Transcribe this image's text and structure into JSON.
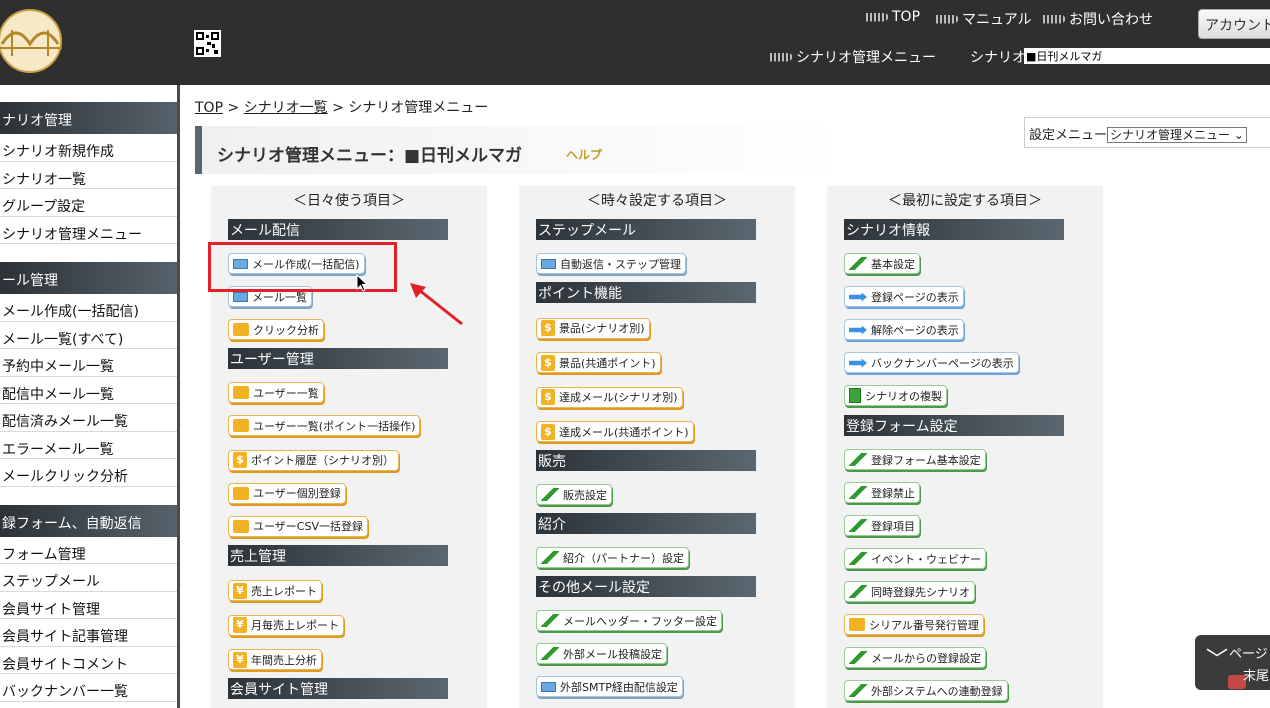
{
  "header": {
    "nav": [
      "TOP",
      "マニュアル",
      "お問い合わせ"
    ],
    "account_button": "アカウント",
    "scenario_menu_link": "シナリオ管理メニュー",
    "scenario_label": "シナリオ",
    "scenario_selected": "■日刊メルマガ"
  },
  "sidebar": {
    "sections": [
      {
        "title": "ナリオ管理",
        "items": [
          "シナリオ新規作成",
          "シナリオ一覧",
          "グループ設定",
          "シナリオ管理メニュー"
        ]
      },
      {
        "title": "ール管理",
        "items": [
          "メール作成(一括配信)",
          "メール一覧(すべて)",
          "予約中メール一覧",
          "配信中メール一覧",
          "配信済みメール一覧",
          "エラーメール一覧",
          "メールクリック分析"
        ]
      },
      {
        "title": "録フォーム、自動返信",
        "items": [
          "フォーム管理",
          "ステップメール",
          "会員サイト管理",
          "会員サイト記事管理",
          "会員サイトコメント",
          "バックナンバー一覧"
        ]
      }
    ]
  },
  "breadcrumb": {
    "top": "TOP",
    "sep": ">",
    "list": "シナリオ一覧",
    "current": "シナリオ管理メニュー"
  },
  "page": {
    "title": "シナリオ管理メニュー：■日刊メルマガ",
    "help": "ヘルプ",
    "settings_label": "設定メニュー",
    "settings_selected": "シナリオ管理メニュー"
  },
  "columns": [
    {
      "heading": "＜日々使う項目＞",
      "sections": [
        {
          "title": "メール配信",
          "items": [
            {
              "label": "メール作成(一括配信)",
              "icon": "mail-icon"
            },
            {
              "label": "メール一覧",
              "icon": "mail-icon"
            },
            {
              "label": "クリック分析",
              "icon": "card-icon"
            }
          ]
        },
        {
          "title": "ユーザー管理",
          "items": [
            {
              "label": "ユーザー一覧",
              "icon": "card-icon"
            },
            {
              "label": "ユーザー一覧(ポイント一括操作)",
              "icon": "card-icon"
            },
            {
              "label": "ポイント履歴（シナリオ別）",
              "icon": "coin-icon"
            },
            {
              "label": "ユーザー個別登録",
              "icon": "card-icon"
            },
            {
              "label": "ユーザーCSV一括登録",
              "icon": "card-icon"
            }
          ]
        },
        {
          "title": "売上管理",
          "items": [
            {
              "label": "売上レポート",
              "icon": "yen-icon"
            },
            {
              "label": "月毎売上レポート",
              "icon": "yen-icon"
            },
            {
              "label": "年間売上分析",
              "icon": "yen-icon"
            }
          ]
        },
        {
          "title": "会員サイト管理",
          "items": []
        }
      ]
    },
    {
      "heading": "＜時々設定する項目＞",
      "sections": [
        {
          "title": "ステップメール",
          "items": [
            {
              "label": "自動返信・ステップ管理",
              "icon": "mail-icon"
            }
          ]
        },
        {
          "title": "ポイント機能",
          "items": [
            {
              "label": "景品(シナリオ別)",
              "icon": "coin-icon"
            },
            {
              "label": "景品(共通ポイント)",
              "icon": "coin-icon"
            },
            {
              "label": "達成メール(シナリオ別)",
              "icon": "coin-icon"
            },
            {
              "label": "達成メール(共通ポイント)",
              "icon": "coin-icon"
            }
          ]
        },
        {
          "title": "販売",
          "items": [
            {
              "label": "販売設定",
              "icon": "pen-icon"
            }
          ]
        },
        {
          "title": "紹介",
          "items": [
            {
              "label": "紹介（パートナー）設定",
              "icon": "pen-icon"
            }
          ]
        },
        {
          "title": "その他メール設定",
          "items": [
            {
              "label": "メールヘッダー・フッター設定",
              "icon": "pen-icon"
            },
            {
              "label": "外部メール投稿設定",
              "icon": "pen-icon"
            },
            {
              "label": "外部SMTP経由配信設定",
              "icon": "mail-icon"
            }
          ]
        }
      ]
    },
    {
      "heading": "＜最初に設定する項目＞",
      "sections": [
        {
          "title": "シナリオ情報",
          "items": [
            {
              "label": "基本設定",
              "icon": "pen-icon"
            },
            {
              "label": "登録ページの表示",
              "icon": "arrow-icon"
            },
            {
              "label": "解除ページの表示",
              "icon": "arrow-icon"
            },
            {
              "label": "バックナンバーページの表示",
              "icon": "arrow-icon"
            },
            {
              "label": "シナリオの複製",
              "icon": "copy-icon"
            }
          ]
        },
        {
          "title": "登録フォーム設定",
          "items": [
            {
              "label": "登録フォーム基本設定",
              "icon": "pen-icon"
            },
            {
              "label": "登録禁止",
              "icon": "pen-icon"
            },
            {
              "label": "登録項目",
              "icon": "pen-icon"
            },
            {
              "label": "イベント・ウェビナー",
              "icon": "pen-icon"
            },
            {
              "label": "同時登録先シナリオ",
              "icon": "pen-icon"
            },
            {
              "label": "シリアル番号発行管理",
              "icon": "card-icon"
            },
            {
              "label": "メールからの登録設定",
              "icon": "pen-icon"
            },
            {
              "label": "外部システムへの連動登録",
              "icon": "pen-icon"
            }
          ]
        }
      ]
    }
  ],
  "page_tab": {
    "line1": "ページ",
    "line2": "末尾"
  },
  "colors": {
    "header_bg": "#2f2f2f",
    "section_dark": "#2c3339",
    "highlight_red": "#e0212a",
    "help_gold": "#c79d18"
  }
}
